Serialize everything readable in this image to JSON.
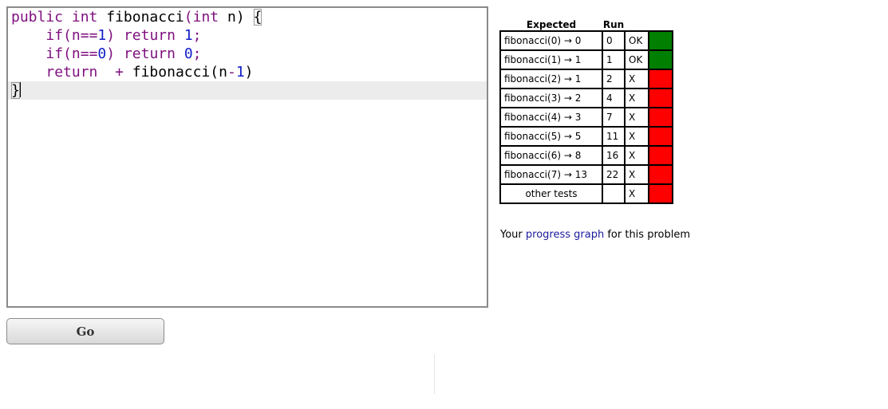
{
  "editor": {
    "line1": {
      "kw1": "public",
      "kw2": "int",
      "name": "fibonacci",
      "open": "(",
      "kw3": "int",
      "param": "n) ",
      "brace": "{"
    },
    "line2": {
      "indent": "    ",
      "kw": "if",
      "p1": "(n",
      "op": "==",
      "num": "1",
      "p2": ") ",
      "ret": "return",
      "sp": " ",
      "val": "1",
      "end": ";"
    },
    "line3": {
      "indent": "    ",
      "kw": "if",
      "p1": "(n",
      "op": "==",
      "num": "0",
      "p2": ") ",
      "ret": "return",
      "sp": " ",
      "val": "0",
      "end": ";"
    },
    "line4": {
      "indent": "    ",
      "ret": "return",
      "gap": "  ",
      "op": "+",
      "call": " fibonacci(n",
      "minus": "-",
      "num": "1",
      "close": ")"
    },
    "line5": {
      "brace": "}"
    }
  },
  "go_button": {
    "label": "Go"
  },
  "results": {
    "headers": {
      "expected": "Expected",
      "run": "Run"
    },
    "rows": [
      {
        "expected": "fibonacci(0) → 0",
        "run": "0",
        "status": "OK",
        "passed": true
      },
      {
        "expected": "fibonacci(1) → 1",
        "run": "1",
        "status": "OK",
        "passed": true
      },
      {
        "expected": "fibonacci(2) → 1",
        "run": "2",
        "status": "X",
        "passed": false
      },
      {
        "expected": "fibonacci(3) → 2",
        "run": "4",
        "status": "X",
        "passed": false
      },
      {
        "expected": "fibonacci(4) → 3",
        "run": "7",
        "status": "X",
        "passed": false
      },
      {
        "expected": "fibonacci(5) → 5",
        "run": "11",
        "status": "X",
        "passed": false
      },
      {
        "expected": "fibonacci(6) → 8",
        "run": "16",
        "status": "X",
        "passed": false
      },
      {
        "expected": "fibonacci(7) → 13",
        "run": "22",
        "status": "X",
        "passed": false
      },
      {
        "expected": "other tests",
        "run": "",
        "status": "X",
        "passed": false
      }
    ],
    "colors": {
      "pass": "#007f00",
      "fail": "#ff0000"
    }
  },
  "progress": {
    "prefix": "Your ",
    "link": "progress graph",
    "suffix": " for this problem"
  }
}
